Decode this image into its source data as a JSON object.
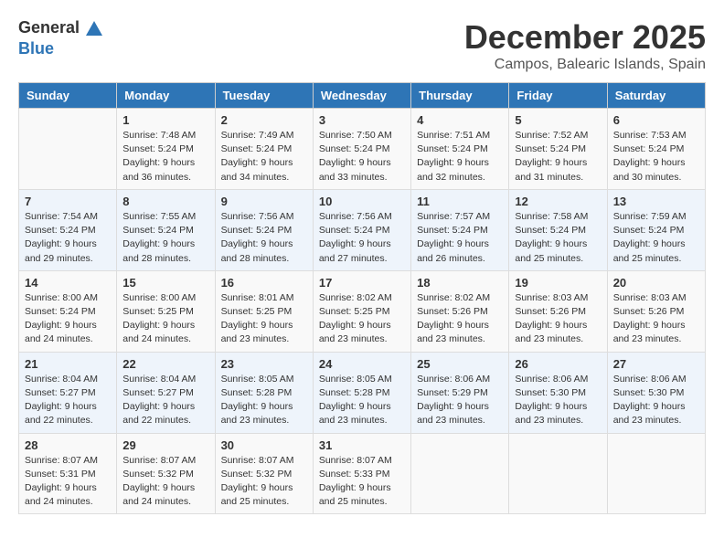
{
  "header": {
    "logo_general": "General",
    "logo_blue": "Blue",
    "month": "December 2025",
    "location": "Campos, Balearic Islands, Spain"
  },
  "days_of_week": [
    "Sunday",
    "Monday",
    "Tuesday",
    "Wednesday",
    "Thursday",
    "Friday",
    "Saturday"
  ],
  "weeks": [
    [
      {
        "day": "",
        "info": ""
      },
      {
        "day": "1",
        "info": "Sunrise: 7:48 AM\nSunset: 5:24 PM\nDaylight: 9 hours\nand 36 minutes."
      },
      {
        "day": "2",
        "info": "Sunrise: 7:49 AM\nSunset: 5:24 PM\nDaylight: 9 hours\nand 34 minutes."
      },
      {
        "day": "3",
        "info": "Sunrise: 7:50 AM\nSunset: 5:24 PM\nDaylight: 9 hours\nand 33 minutes."
      },
      {
        "day": "4",
        "info": "Sunrise: 7:51 AM\nSunset: 5:24 PM\nDaylight: 9 hours\nand 32 minutes."
      },
      {
        "day": "5",
        "info": "Sunrise: 7:52 AM\nSunset: 5:24 PM\nDaylight: 9 hours\nand 31 minutes."
      },
      {
        "day": "6",
        "info": "Sunrise: 7:53 AM\nSunset: 5:24 PM\nDaylight: 9 hours\nand 30 minutes."
      }
    ],
    [
      {
        "day": "7",
        "info": "Sunrise: 7:54 AM\nSunset: 5:24 PM\nDaylight: 9 hours\nand 29 minutes."
      },
      {
        "day": "8",
        "info": "Sunrise: 7:55 AM\nSunset: 5:24 PM\nDaylight: 9 hours\nand 28 minutes."
      },
      {
        "day": "9",
        "info": "Sunrise: 7:56 AM\nSunset: 5:24 PM\nDaylight: 9 hours\nand 28 minutes."
      },
      {
        "day": "10",
        "info": "Sunrise: 7:56 AM\nSunset: 5:24 PM\nDaylight: 9 hours\nand 27 minutes."
      },
      {
        "day": "11",
        "info": "Sunrise: 7:57 AM\nSunset: 5:24 PM\nDaylight: 9 hours\nand 26 minutes."
      },
      {
        "day": "12",
        "info": "Sunrise: 7:58 AM\nSunset: 5:24 PM\nDaylight: 9 hours\nand 25 minutes."
      },
      {
        "day": "13",
        "info": "Sunrise: 7:59 AM\nSunset: 5:24 PM\nDaylight: 9 hours\nand 25 minutes."
      }
    ],
    [
      {
        "day": "14",
        "info": "Sunrise: 8:00 AM\nSunset: 5:24 PM\nDaylight: 9 hours\nand 24 minutes."
      },
      {
        "day": "15",
        "info": "Sunrise: 8:00 AM\nSunset: 5:25 PM\nDaylight: 9 hours\nand 24 minutes."
      },
      {
        "day": "16",
        "info": "Sunrise: 8:01 AM\nSunset: 5:25 PM\nDaylight: 9 hours\nand 23 minutes."
      },
      {
        "day": "17",
        "info": "Sunrise: 8:02 AM\nSunset: 5:25 PM\nDaylight: 9 hours\nand 23 minutes."
      },
      {
        "day": "18",
        "info": "Sunrise: 8:02 AM\nSunset: 5:26 PM\nDaylight: 9 hours\nand 23 minutes."
      },
      {
        "day": "19",
        "info": "Sunrise: 8:03 AM\nSunset: 5:26 PM\nDaylight: 9 hours\nand 23 minutes."
      },
      {
        "day": "20",
        "info": "Sunrise: 8:03 AM\nSunset: 5:26 PM\nDaylight: 9 hours\nand 23 minutes."
      }
    ],
    [
      {
        "day": "21",
        "info": "Sunrise: 8:04 AM\nSunset: 5:27 PM\nDaylight: 9 hours\nand 22 minutes."
      },
      {
        "day": "22",
        "info": "Sunrise: 8:04 AM\nSunset: 5:27 PM\nDaylight: 9 hours\nand 22 minutes."
      },
      {
        "day": "23",
        "info": "Sunrise: 8:05 AM\nSunset: 5:28 PM\nDaylight: 9 hours\nand 23 minutes."
      },
      {
        "day": "24",
        "info": "Sunrise: 8:05 AM\nSunset: 5:28 PM\nDaylight: 9 hours\nand 23 minutes."
      },
      {
        "day": "25",
        "info": "Sunrise: 8:06 AM\nSunset: 5:29 PM\nDaylight: 9 hours\nand 23 minutes."
      },
      {
        "day": "26",
        "info": "Sunrise: 8:06 AM\nSunset: 5:30 PM\nDaylight: 9 hours\nand 23 minutes."
      },
      {
        "day": "27",
        "info": "Sunrise: 8:06 AM\nSunset: 5:30 PM\nDaylight: 9 hours\nand 23 minutes."
      }
    ],
    [
      {
        "day": "28",
        "info": "Sunrise: 8:07 AM\nSunset: 5:31 PM\nDaylight: 9 hours\nand 24 minutes."
      },
      {
        "day": "29",
        "info": "Sunrise: 8:07 AM\nSunset: 5:32 PM\nDaylight: 9 hours\nand 24 minutes."
      },
      {
        "day": "30",
        "info": "Sunrise: 8:07 AM\nSunset: 5:32 PM\nDaylight: 9 hours\nand 25 minutes."
      },
      {
        "day": "31",
        "info": "Sunrise: 8:07 AM\nSunset: 5:33 PM\nDaylight: 9 hours\nand 25 minutes."
      },
      {
        "day": "",
        "info": ""
      },
      {
        "day": "",
        "info": ""
      },
      {
        "day": "",
        "info": ""
      }
    ]
  ]
}
